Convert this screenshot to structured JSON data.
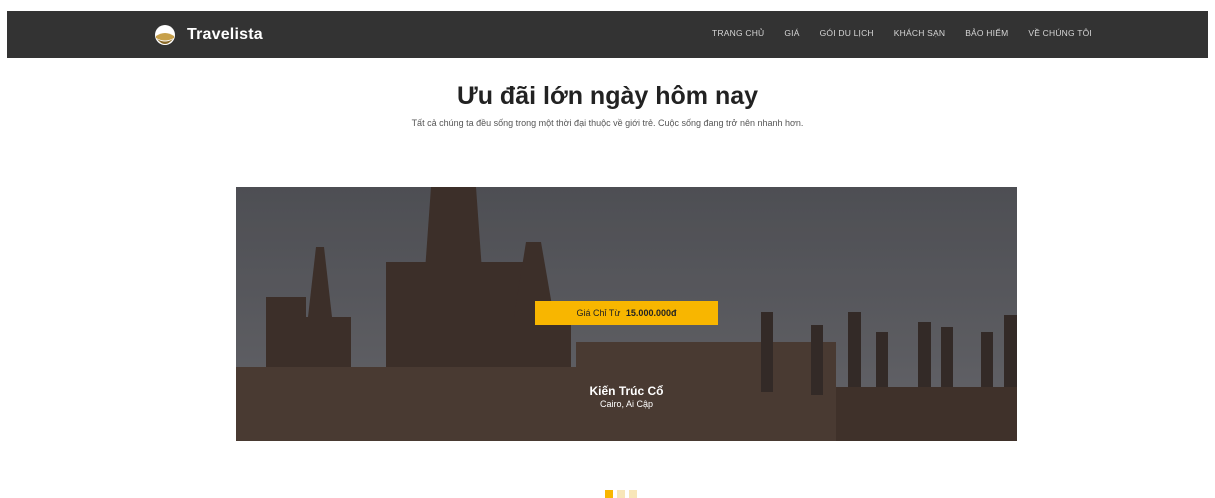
{
  "brand": {
    "name": "Travelista"
  },
  "nav": {
    "items": [
      "TRANG CHỦ",
      "GIÁ",
      "GÓI DU LỊCH",
      "KHÁCH SẠN",
      "BẢO HIỂM",
      "VỀ CHÚNG TÔI"
    ]
  },
  "hero": {
    "title": "Ưu đãi lớn ngày hôm nay",
    "subtitle": "Tất cả chúng ta đều sống trong một thời đại thuộc về giới trẻ. Cuộc sống đang trở nên nhanh hơn."
  },
  "slide": {
    "price_prefix": "Giá Chỉ Từ",
    "price_value": "15.000.000đ",
    "title": "Kiến Trúc Cổ",
    "location": "Cairo, Ai Cập"
  },
  "carousel": {
    "active_index": 0,
    "dot_count": 3
  },
  "colors": {
    "accent": "#f8b600",
    "navbar": "#333333"
  }
}
